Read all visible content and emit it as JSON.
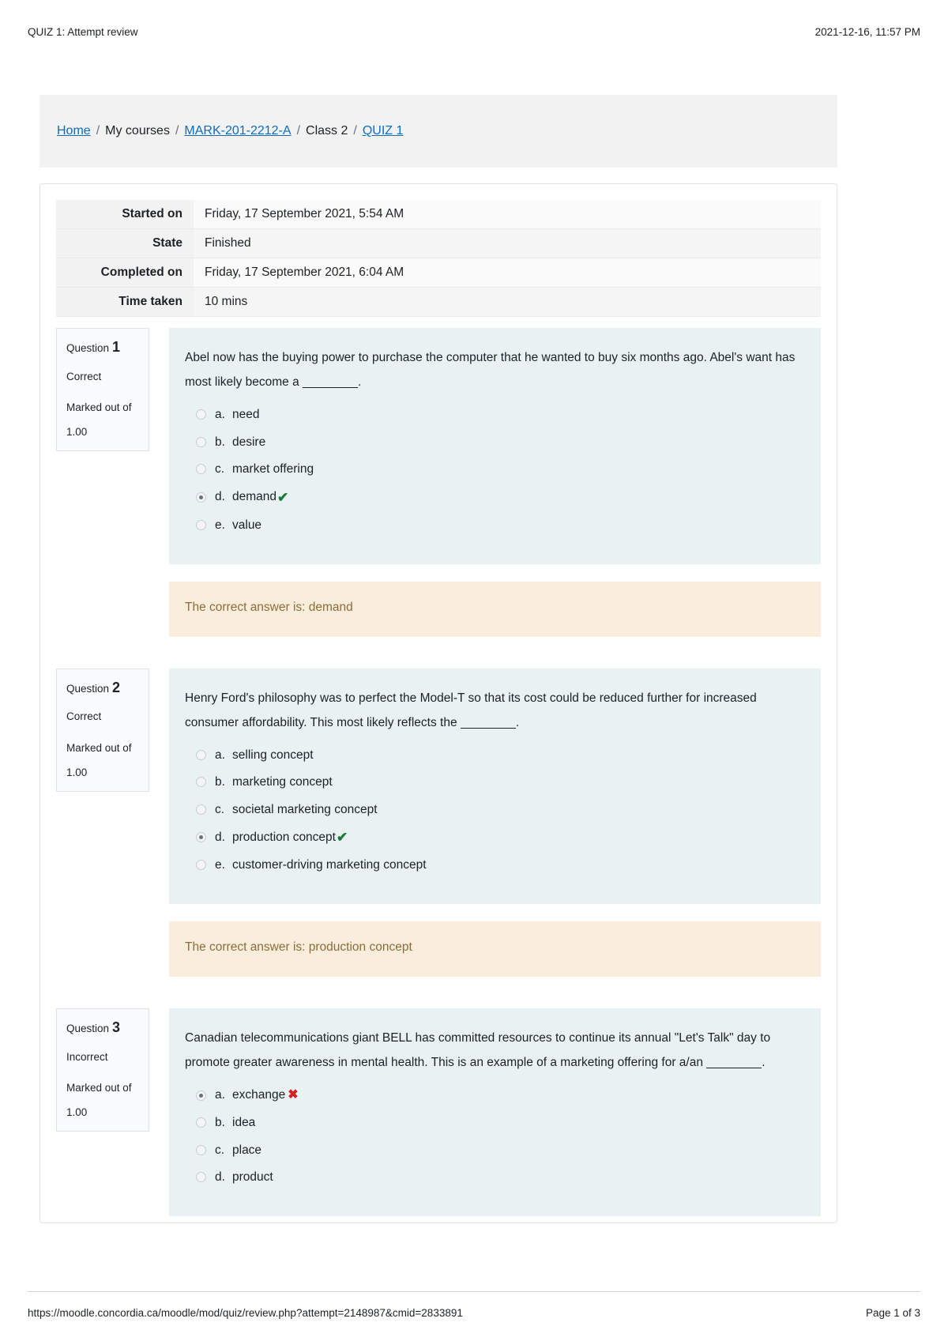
{
  "print": {
    "header_title": "QUIZ 1: Attempt review",
    "header_date": "2021-12-16, 11:57 PM",
    "footer_url": "https://moodle.concordia.ca/moodle/mod/quiz/review.php?attempt=2148987&cmid=2833891",
    "footer_page": "Page 1 of 3"
  },
  "breadcrumb": {
    "items": [
      {
        "label": "Home",
        "link": true
      },
      {
        "label": "My courses",
        "link": false
      },
      {
        "label": "MARK-201-2212-A",
        "link": true
      },
      {
        "label": "Class 2",
        "link": false
      },
      {
        "label": "QUIZ 1",
        "link": true
      }
    ],
    "separator": "/"
  },
  "summary": {
    "rows": [
      {
        "label": "Started on",
        "value": "Friday, 17 September 2021, 5:54 AM"
      },
      {
        "label": "State",
        "value": "Finished"
      },
      {
        "label": "Completed on",
        "value": "Friday, 17 September 2021, 6:04 AM"
      },
      {
        "label": "Time taken",
        "value": "10 mins"
      }
    ]
  },
  "labels": {
    "question_word": "Question",
    "marked_out_of": "Marked out of",
    "correct_mark": "✔",
    "wrong_mark": "✖"
  },
  "questions": [
    {
      "number": "1",
      "state": "Correct",
      "marked_out_of": "Marked out of",
      "grade": "1.00",
      "text_before_blank": "Abel now has the buying power to purchase the computer that he wanted to buy six months ago. Abel's want has most likely become a ",
      "text_after_blank": ".",
      "options": [
        {
          "letter": "a.",
          "text": "need",
          "selected": false,
          "mark": ""
        },
        {
          "letter": "b.",
          "text": "desire",
          "selected": false,
          "mark": ""
        },
        {
          "letter": "c.",
          "text": "market offering",
          "selected": false,
          "mark": ""
        },
        {
          "letter": "d.",
          "text": "demand",
          "selected": true,
          "mark": "correct"
        },
        {
          "letter": "e.",
          "text": "value",
          "selected": false,
          "mark": ""
        }
      ],
      "feedback": "The correct answer is: demand"
    },
    {
      "number": "2",
      "state": "Correct",
      "marked_out_of": "Marked out of",
      "grade": "1.00",
      "text_before_blank": "Henry Ford's philosophy was to perfect the Model-T so that its cost could be reduced further for increased consumer affordability. This most likely reflects the ",
      "text_after_blank": ".",
      "options": [
        {
          "letter": "a.",
          "text": "selling concept",
          "selected": false,
          "mark": ""
        },
        {
          "letter": "b.",
          "text": "marketing concept",
          "selected": false,
          "mark": ""
        },
        {
          "letter": "c.",
          "text": "societal marketing concept",
          "selected": false,
          "mark": ""
        },
        {
          "letter": "d.",
          "text": "production concept",
          "selected": true,
          "mark": "correct"
        },
        {
          "letter": "e.",
          "text": "customer-driving marketing concept",
          "selected": false,
          "mark": ""
        }
      ],
      "feedback": "The correct answer is: production concept"
    },
    {
      "number": "3",
      "state": "Incorrect",
      "marked_out_of": "Marked out of",
      "grade": "1.00",
      "text_before_blank": "Canadian telecommunications giant BELL has committed resources to continue its annual \"Let's Talk\" day to promote greater awareness in mental health. This is an example of a marketing offering for a/an ",
      "text_after_blank": ".",
      "options": [
        {
          "letter": "a.",
          "text": "exchange",
          "selected": true,
          "mark": "wrong"
        },
        {
          "letter": "b.",
          "text": "idea",
          "selected": false,
          "mark": ""
        },
        {
          "letter": "c.",
          "text": "place",
          "selected": false,
          "mark": ""
        },
        {
          "letter": "d.",
          "text": "product",
          "selected": false,
          "mark": ""
        }
      ],
      "feedback": ""
    }
  ]
}
